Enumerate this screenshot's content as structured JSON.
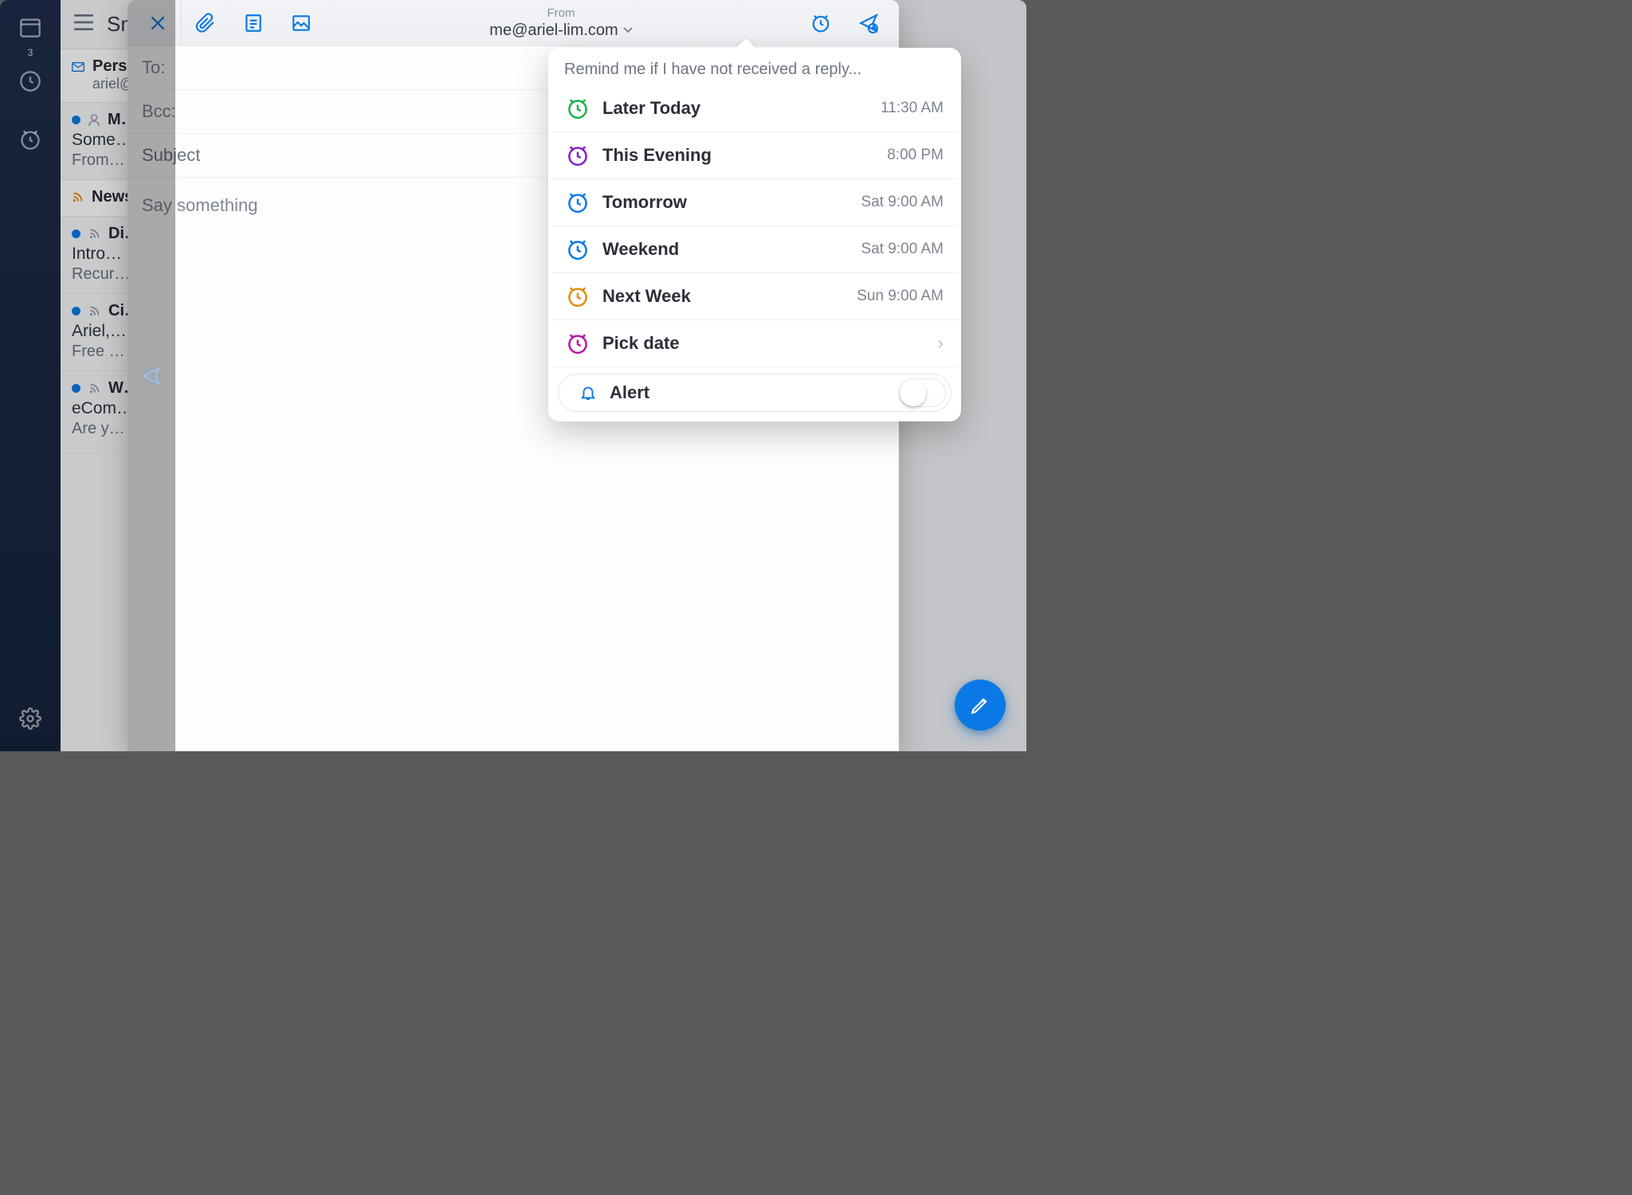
{
  "rail": {
    "calendar_day": "3"
  },
  "list": {
    "folder_title": "Sm…",
    "folders": [
      {
        "name": "Person…",
        "meta": "ariel@…"
      }
    ],
    "messages": [
      {
        "sender": "M…",
        "subject": "Some…",
        "preview": "From…"
      },
      {
        "sender": "Newsl…",
        "subject": "",
        "preview": ""
      },
      {
        "sender": "Di…",
        "subject": "Intro…",
        "preview": "Recur…"
      },
      {
        "sender": "Ci…",
        "subject": "Ariel,…",
        "preview": "Free …"
      },
      {
        "sender": "W…",
        "subject": "eCom…",
        "preview": "Are y…"
      }
    ]
  },
  "compose": {
    "from_label": "From",
    "from_value": "me@ariel-lim.com",
    "to_label": "To:",
    "bcc_label": "Bcc:",
    "subject_placeholder": "Subject",
    "body_placeholder": "Say something"
  },
  "popover": {
    "heading": "Remind me if I have not received a reply...",
    "options": [
      {
        "label": "Later Today",
        "time": "11:30 AM",
        "color": "#19b34a"
      },
      {
        "label": "This Evening",
        "time": "8:00 PM",
        "color": "#8421c7"
      },
      {
        "label": "Tomorrow",
        "time": "Sat 9:00 AM",
        "color": "#0b79e5"
      },
      {
        "label": "Weekend",
        "time": "Sat 9:00 AM",
        "color": "#0b79e5"
      },
      {
        "label": "Next Week",
        "time": "Sun 9:00 AM",
        "color": "#e58b0b"
      }
    ],
    "pick_date_label": "Pick date",
    "pick_date_color": "#b517a1",
    "alert_label": "Alert",
    "alert_on": false
  }
}
